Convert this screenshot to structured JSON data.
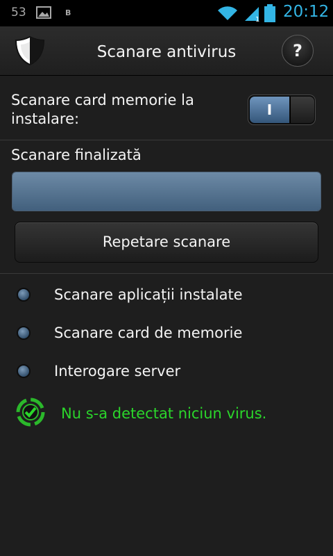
{
  "status_bar": {
    "notification_count": "53",
    "notification_icons": [
      "gallery-icon",
      "b-icon"
    ],
    "b_glyph": "B",
    "system_icons": [
      "wifi-icon",
      "signal-icon",
      "battery-icon"
    ],
    "clock": "20:12",
    "clock_color": "#33b5e5"
  },
  "header": {
    "app_icon": "shield-icon",
    "title": "Scanare antivirus",
    "help_label": "?"
  },
  "settings": {
    "sd_scan_label": "Scanare card memorie la instalare:",
    "sd_scan_toggle": {
      "state": "on",
      "on_label": "I"
    }
  },
  "scan": {
    "status": "Scanare finalizată",
    "progress_fraction": 1.0,
    "repeat_button": "Repetare scanare"
  },
  "steps": [
    {
      "label": "Scanare aplicații instalate"
    },
    {
      "label": "Scanare card de memorie"
    },
    {
      "label": "Interogare server"
    }
  ],
  "result": {
    "icon": "check-target-icon",
    "text": "Nu s-a detectat niciun virus.",
    "color": "#2bd62b"
  }
}
